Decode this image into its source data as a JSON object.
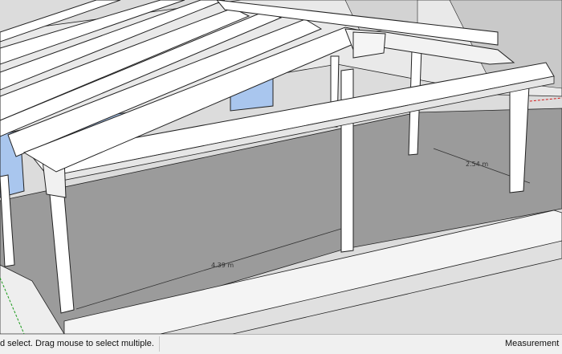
{
  "viewport": {
    "dimensions": [
      {
        "name": "width-dimension",
        "text": "4.39 m"
      },
      {
        "name": "depth-dimension",
        "text": "2.54 m"
      }
    ]
  },
  "status_bar": {
    "hint": "d select. Drag mouse to select multiple.",
    "measurements_label": "Measurement"
  },
  "colors": {
    "ground": "#9b9b9b",
    "beam_top": "#ffffff",
    "beam_side": "#e6e6e6",
    "outline": "#222222",
    "window_glass": "#a9c6ee",
    "axis_red": "#d11a1a",
    "axis_green": "#1a9a1a"
  }
}
